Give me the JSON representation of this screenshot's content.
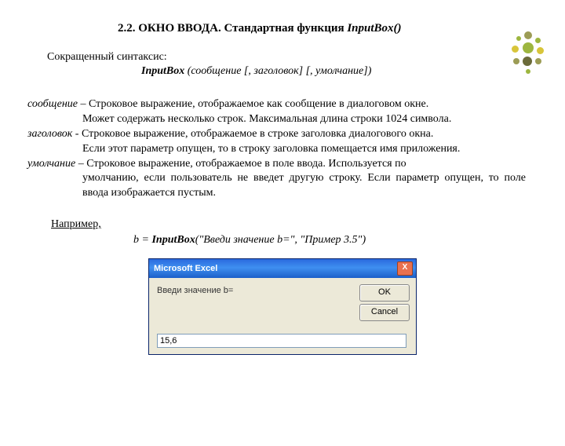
{
  "title_prefix": "2.2. ОКНО ВВОДА. Стандартная функция  ",
  "title_func": "InputBox()",
  "syntax_label": "Сокращенный синтаксис:",
  "syntax_bold": "InputBox",
  "syntax_rest": " (сообщение [, заголовок]  [, умолчание])",
  "param1_name": "сообщение",
  "param1_start": " – Строковое выражение, отображаемое как сообщение в диалоговом окне.",
  "param1_more": "Может содержать несколько строк. Максимальная длина строки 1024 символа.",
  "param2_name": "заголовок",
  "param2_start": "  - Строковое выражение, отображаемое в строке заголовка диалогового окна.",
  "param2_more": "Если этот параметр опущен, то в строку заголовка помещается имя приложения.",
  "param3_name": "умолчание",
  "param3_start": " – Строковое выражение, отображаемое в поле ввода. Используется по",
  "param3_more": "умолчанию, если пользователь не введет другую строку. Если параметр опущен, то поле ввода изображается пустым.",
  "example_label": "Например,",
  "code_var": "b = ",
  "code_func": "InputBox",
  "code_args": "(\"Введи значение b=\", \"Пример 3.5\")",
  "dialog": {
    "title": "Microsoft Excel",
    "prompt": "Введи значение b=",
    "ok": "OK",
    "cancel": "Cancel",
    "close": "X",
    "value": "15,6"
  },
  "deco_colors": {
    "g": "#9db63f",
    "y": "#d8c53a",
    "gy": "#9c9c55",
    "dk": "#6b6b3a"
  }
}
